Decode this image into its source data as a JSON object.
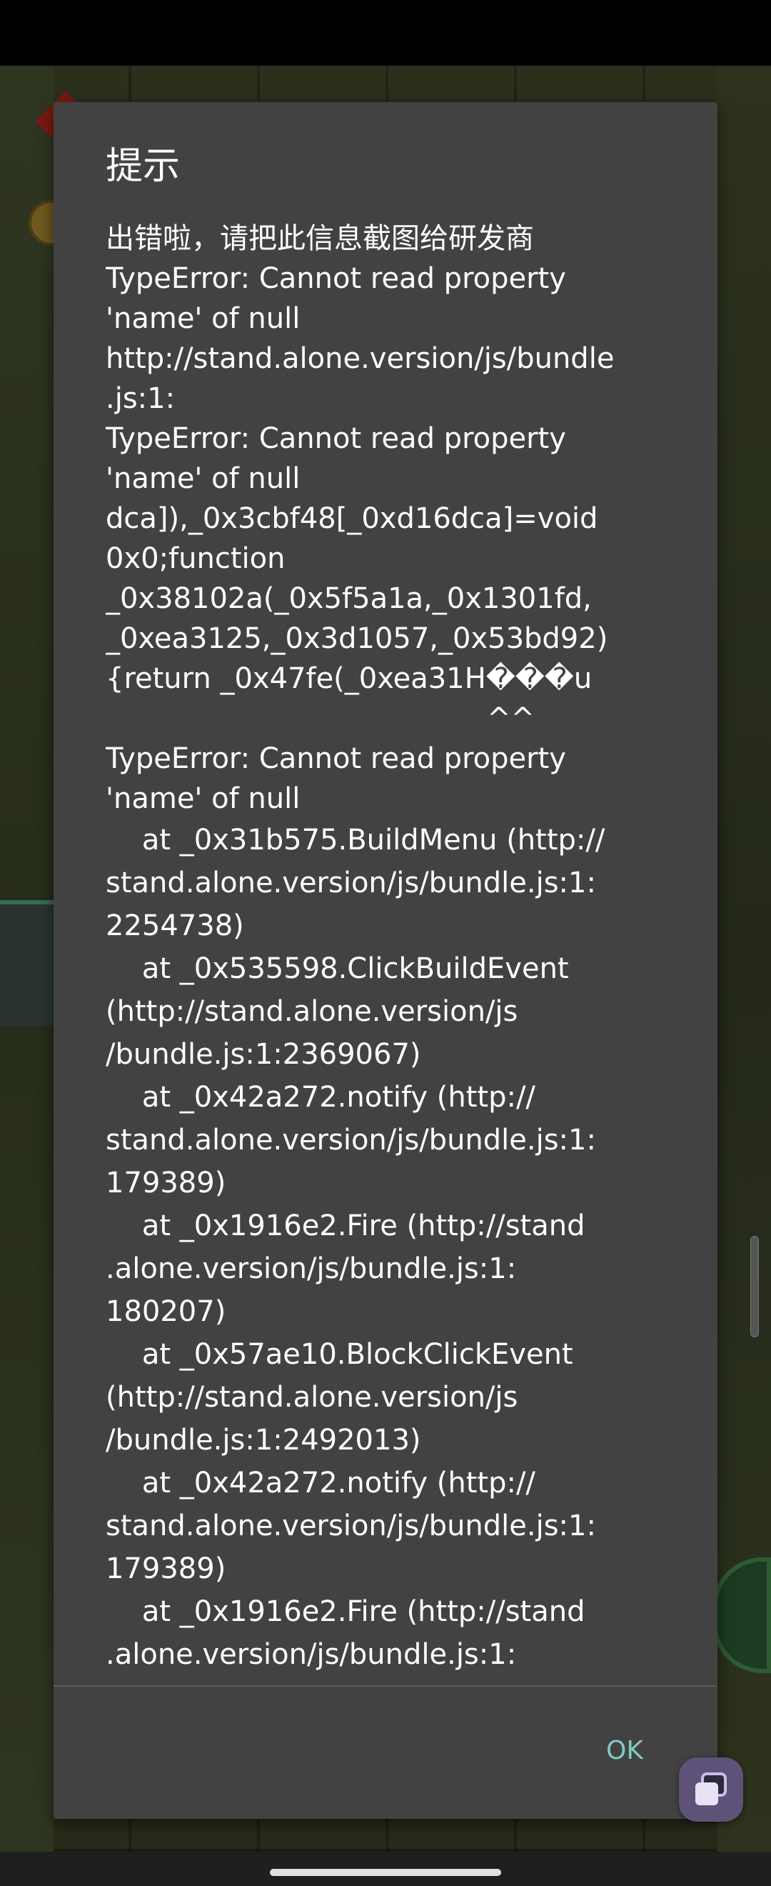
{
  "dialog": {
    "title": "提示",
    "message_lines": [
      "出错啦，请把此信息截图给研发商",
      "TypeError: Cannot read property",
      "'name' of null",
      "http://stand.alone.version/js/bundle",
      ".js:1:",
      "TypeError: Cannot read property",
      "'name' of null",
      "dca]),_0x3cbf48[_0xd16dca]=void",
      "0x0;function",
      "_0x38102a(_0x5f5a1a,_0x1301fd,",
      "_0xea3125,_0x3d1057,_0x53bd92)",
      "{return _0x47fe(_0xea31H���u",
      "                                          ^^",
      "TypeError: Cannot read property",
      "'name' of null",
      "    at _0x31b575.BuildMenu (http://",
      "stand.alone.version/js/bundle.js:1:",
      "2254738)",
      "    at _0x535598.ClickBuildEvent",
      "(http://stand.alone.version/js",
      "/bundle.js:1:2369067)",
      "    at _0x42a272.notify (http://",
      "stand.alone.version/js/bundle.js:1:",
      "179389)",
      "    at _0x1916e2.Fire (http://stand",
      ".alone.version/js/bundle.js:1:",
      "180207)",
      "    at _0x57ae10.BlockClickEvent",
      "(http://stand.alone.version/js",
      "/bundle.js:1:2492013)",
      "    at _0x42a272.notify (http://",
      "stand.alone.version/js/bundle.js:1:",
      "179389)",
      "    at _0x1916e2.Fire (http://stand",
      ".alone.version/js/bundle.js:1:"
    ],
    "ok_label": "OK"
  },
  "icons": {
    "floating_button": "overlapping-windows-icon",
    "home": "home-handle"
  },
  "colors": {
    "dialog_background": "#424242",
    "accent": "#80cbc4",
    "floating_button": "#5e5278"
  }
}
